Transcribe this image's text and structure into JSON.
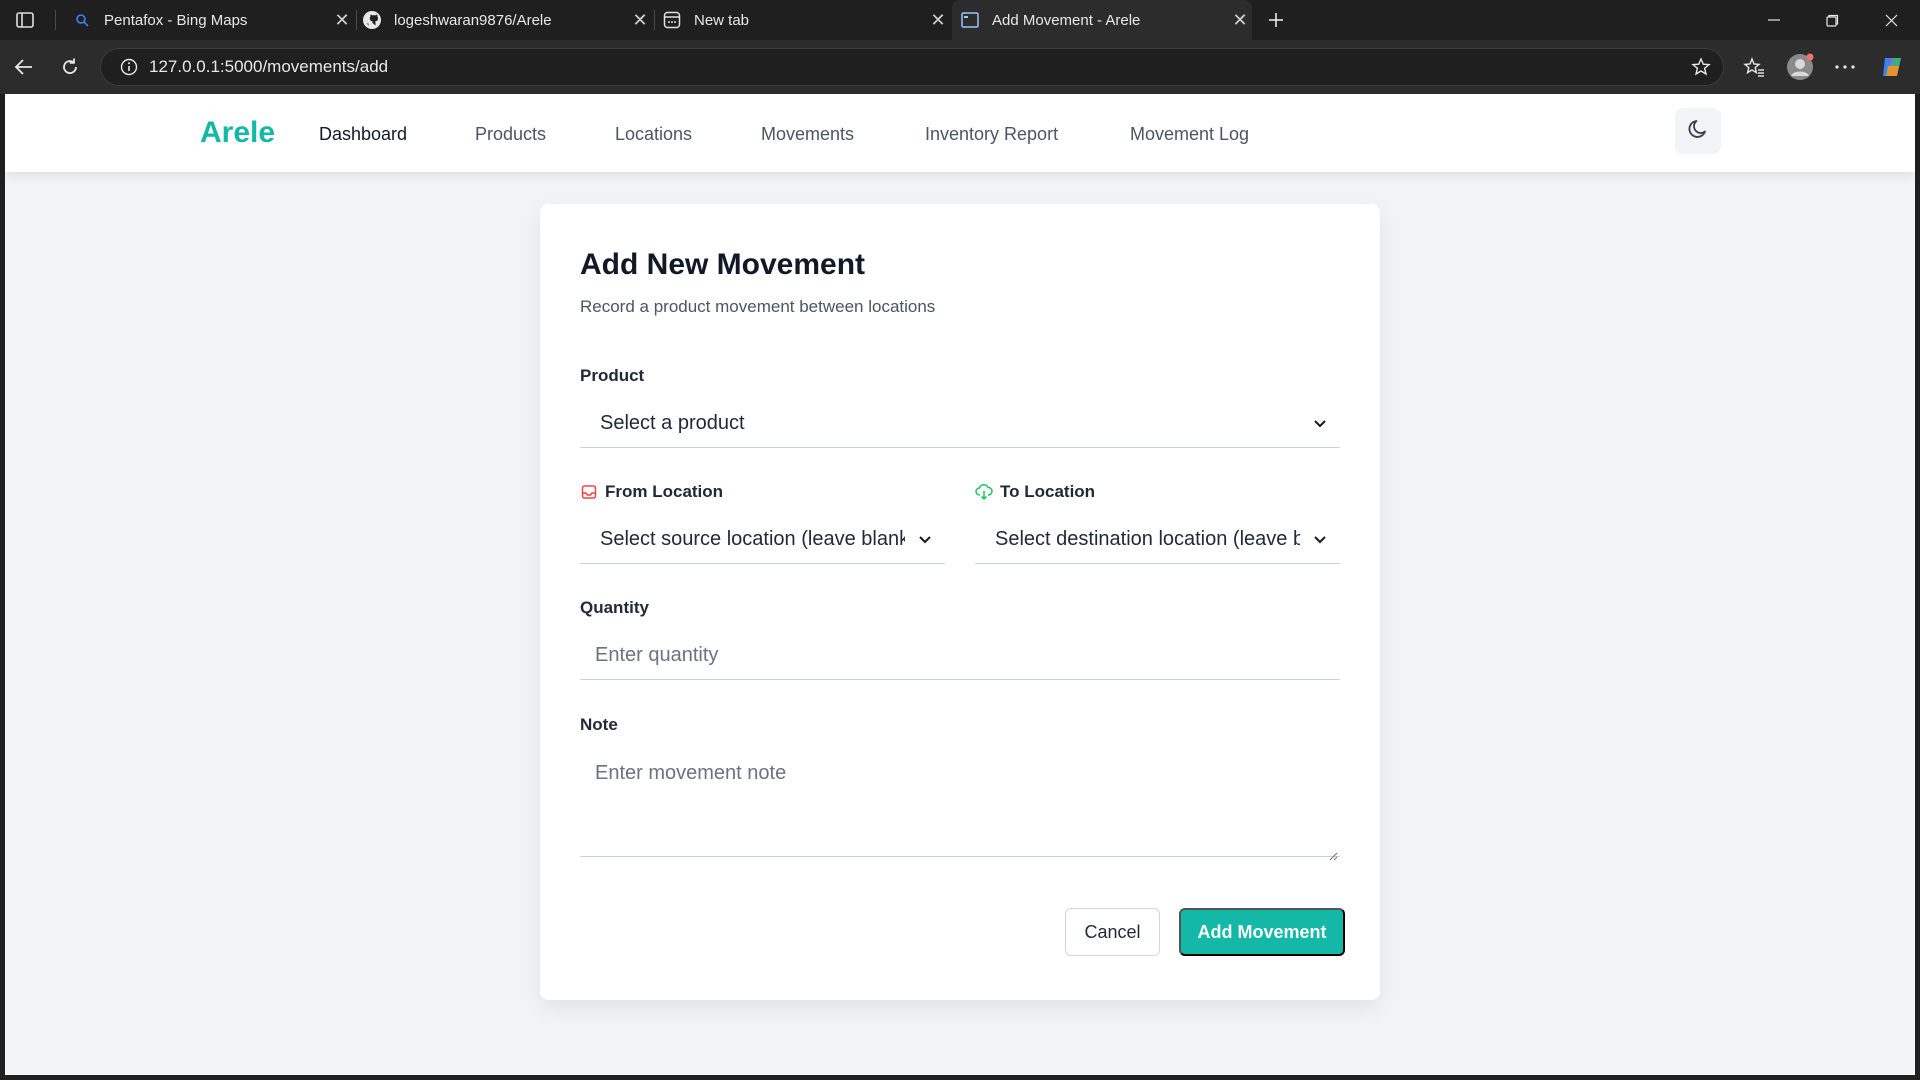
{
  "browser": {
    "tabs": [
      {
        "title": "Pentafox - Bing Maps",
        "icon": "search-icon"
      },
      {
        "title": "logeshwaran9876/Arele",
        "icon": "github-icon"
      },
      {
        "title": "New tab",
        "icon": "newtab-icon"
      },
      {
        "title": "Add Movement - Arele",
        "icon": "page-icon",
        "active": true
      }
    ],
    "url": "127.0.0.1:5000/movements/add"
  },
  "nav": {
    "brand": "Arele",
    "links": [
      "Dashboard",
      "Products",
      "Locations",
      "Movements",
      "Inventory Report",
      "Movement Log"
    ],
    "active": "Dashboard",
    "brand_color": "#14b8a6"
  },
  "form": {
    "title": "Add New Movement",
    "subtitle": "Record a product movement between locations",
    "product": {
      "label": "Product",
      "placeholder": "Select a product"
    },
    "from_location": {
      "label": "From Location",
      "placeholder": "Select source location (leave blank for new stock)",
      "icon": "inbox-icon",
      "icon_color": "#ef4444"
    },
    "to_location": {
      "label": "To Location",
      "placeholder": "Select destination location (leave blank for outgoing)",
      "icon": "cloud-download-icon",
      "icon_color": "#22c55e"
    },
    "quantity": {
      "label": "Quantity",
      "placeholder": "Enter quantity"
    },
    "note": {
      "label": "Note",
      "placeholder": "Enter movement note"
    },
    "cancel_label": "Cancel",
    "submit_label": "Add Movement",
    "accent_color": "#14b8a6"
  }
}
